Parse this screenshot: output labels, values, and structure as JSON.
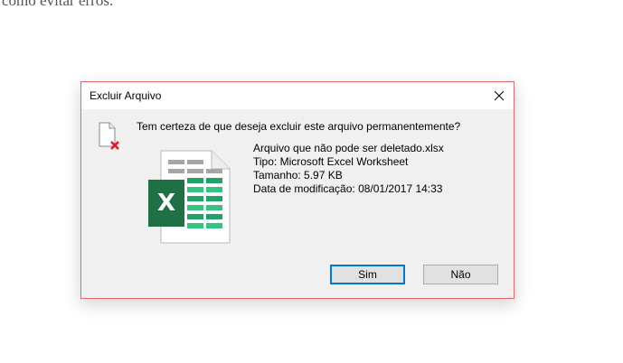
{
  "page": {
    "background_text": "como evitar erros."
  },
  "dialog": {
    "title": "Excluir Arquivo",
    "close_glyph": "✕",
    "question": "Tem certeza de que deseja excluir este arquivo permanentemente?",
    "file": {
      "name": "Arquivo que não pode ser deletado.xlsx",
      "type": "Tipo: Microsoft Excel Worksheet",
      "size": "Tamanho: 5.97 KB",
      "modified": "Data de modificação: 08/01/2017 14:33"
    },
    "excel_badge_letter": "X",
    "buttons": {
      "yes": "Sim",
      "no": "Não"
    },
    "colors": {
      "dialog_border": "#e26a6a",
      "excel_green": "#1e7145",
      "default_button_border": "#0078d7",
      "delete_x": "#e81123"
    },
    "icons": [
      "delete-file-icon",
      "excel-file-icon",
      "close-icon"
    ]
  }
}
